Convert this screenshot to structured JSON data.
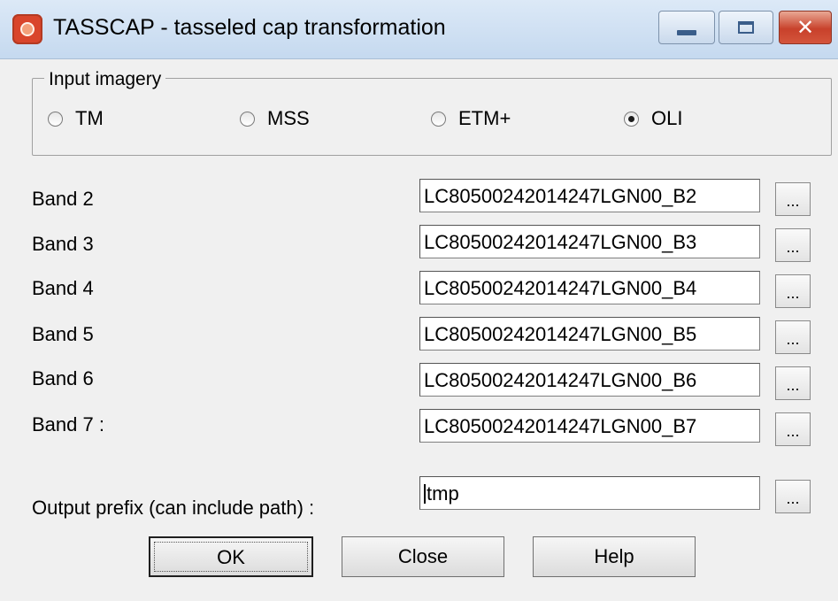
{
  "window": {
    "title": "TASSCAP - tasseled cap transformation",
    "icon": "tasscap-app-icon",
    "controls": [
      "minimize-icon",
      "maximize-icon",
      "close-icon"
    ]
  },
  "input_imagery": {
    "label": "Input imagery",
    "options": [
      {
        "label": "TM",
        "checked": false
      },
      {
        "label": "MSS",
        "checked": false
      },
      {
        "label": "ETM+",
        "checked": false
      },
      {
        "label": "OLI",
        "checked": true
      }
    ]
  },
  "bands": [
    {
      "label": "Band 2",
      "value": "LC80500242014247LGN00_B2"
    },
    {
      "label": "Band 3",
      "value": "LC80500242014247LGN00_B3"
    },
    {
      "label": "Band 4",
      "value": "LC80500242014247LGN00_B4"
    },
    {
      "label": "Band 5",
      "value": "LC80500242014247LGN00_B5"
    },
    {
      "label": "Band 6",
      "value": "LC80500242014247LGN00_B6"
    },
    {
      "label": "Band 7 :",
      "value": "LC80500242014247LGN00_B7"
    }
  ],
  "browse_label": "...",
  "output": {
    "label": "Output prefix (can include path) :",
    "value": "tmp"
  },
  "buttons": {
    "ok": "OK",
    "close": "Close",
    "help": "Help"
  }
}
